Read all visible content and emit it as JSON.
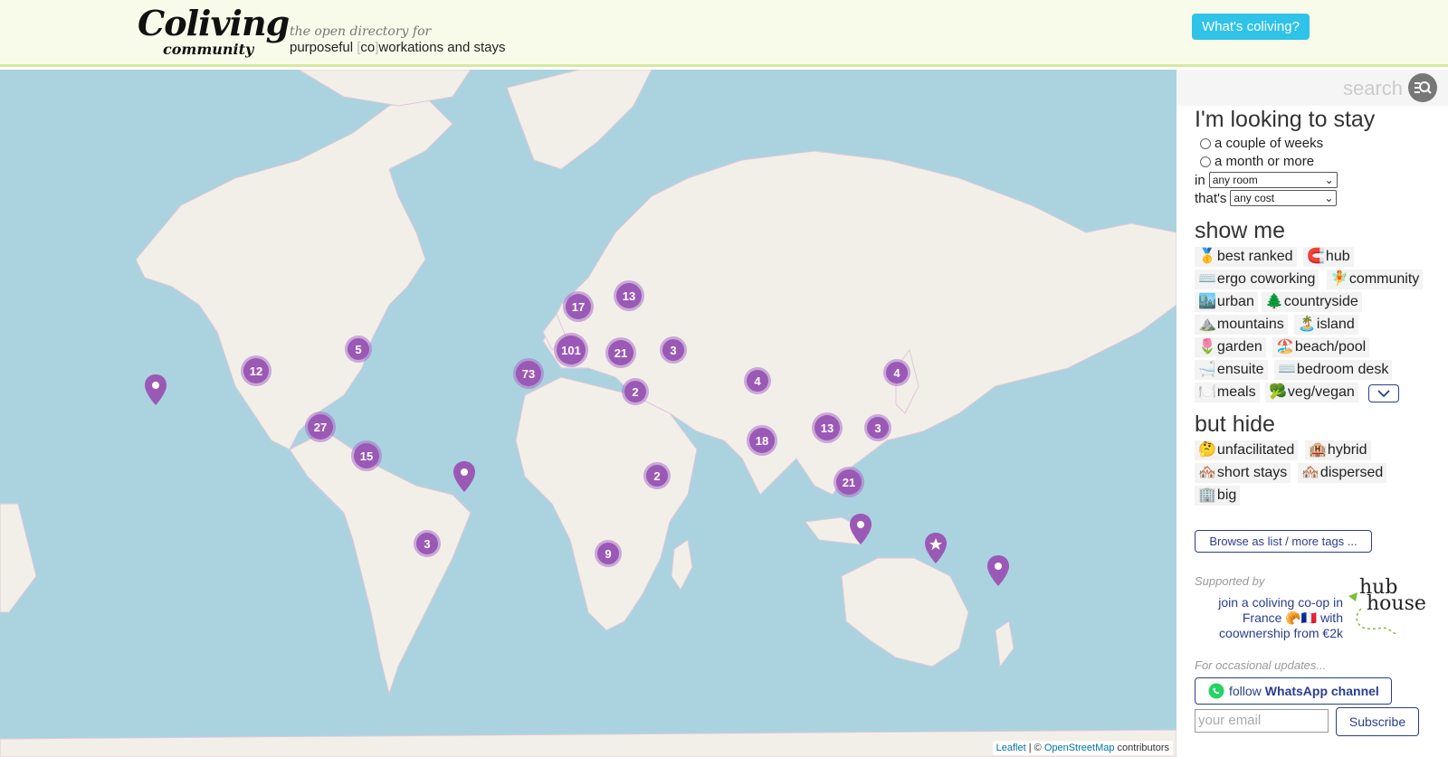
{
  "header": {
    "logo_line1": "Coliving",
    "logo_line2": "community",
    "tagline_line1": "the open directory for",
    "tagline_pre": "purposeful ",
    "tagline_co": "co",
    "tagline_post": "workations and stays",
    "whats_label": "What's coliving?",
    "accent": "#2fc3e8"
  },
  "map": {
    "clusters": [
      "12",
      "5",
      "27",
      "15",
      "3",
      "17",
      "13",
      "101",
      "21",
      "3",
      "73",
      "2",
      "4",
      "18",
      "13",
      "3",
      "4",
      "21",
      "2",
      "9"
    ],
    "attribution_leaflet": "Leaflet",
    "attribution_sep": " | © ",
    "attribution_osm": "OpenStreetMap",
    "attribution_post": " contributors",
    "marker_color": "#9b59b6"
  },
  "sidebar": {
    "search_placeholder": "search",
    "stay_heading": "I'm looking to stay",
    "option_weeks": "a couple of weeks",
    "option_month": "a month or more",
    "in_label": "in",
    "room_value": "any room",
    "thats_label": "that's",
    "cost_value": "any cost",
    "show_heading": "show me",
    "show_tags": [
      {
        "emoji": "🥇",
        "label": "best ranked"
      },
      {
        "emoji": "🧲",
        "label": "hub"
      },
      {
        "emoji": "⌨️",
        "label": "ergo coworking"
      },
      {
        "emoji": "🧚",
        "label": "community"
      },
      {
        "emoji": "🏙️",
        "label": "urban"
      },
      {
        "emoji": "🌲",
        "label": "countryside"
      },
      {
        "emoji": "⛰️",
        "label": "mountains"
      },
      {
        "emoji": "🏝️",
        "label": "island"
      },
      {
        "emoji": "🌷",
        "label": "garden"
      },
      {
        "emoji": "🏖️",
        "label": "beach/pool"
      },
      {
        "emoji": "🛁",
        "label": "ensuite"
      },
      {
        "emoji": "⌨️",
        "label": "bedroom desk"
      },
      {
        "emoji": "🍽️",
        "label": "meals"
      },
      {
        "emoji": "🥦",
        "label": "veg/vegan"
      }
    ],
    "hide_heading": "but hide",
    "hide_tags": [
      {
        "emoji": "🤔",
        "label": "unfacilitated"
      },
      {
        "emoji": "🏨",
        "label": "hybrid"
      },
      {
        "emoji": "🏘️",
        "label": "short stays"
      },
      {
        "emoji": "🏘️",
        "label": "dispersed"
      },
      {
        "emoji": "🏢",
        "label": "big"
      }
    ],
    "browse_label": "Browse as list / more tags ...",
    "supported_by": "Supported by",
    "promo_text": "join a coliving co-op in France 🥐🇫🇷 with coownership from €2k",
    "sponsor_word1": "hub",
    "sponsor_word2": "house",
    "updates_label": "For occasional updates...",
    "whatsapp_follow": "follow",
    "whatsapp_channel": "WhatsApp channel",
    "email_placeholder": "your email",
    "subscribe_label": "Subscribe",
    "link_color": "#2a3d8f"
  }
}
